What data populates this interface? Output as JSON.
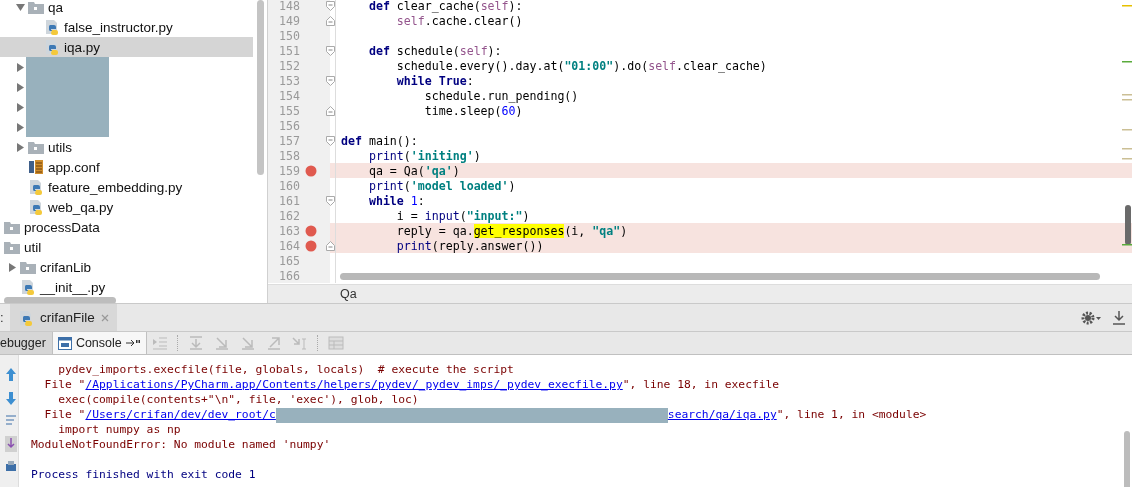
{
  "project_tree": {
    "continued_items": [
      {
        "label": "qa",
        "kind": "folder",
        "expanded": true,
        "selected": false,
        "children": [
          {
            "label": "false_instructor.py",
            "kind": "python",
            "selected": false
          },
          {
            "label": "iqa.py",
            "kind": "python",
            "selected": true
          }
        ]
      },
      {
        "kind": "redacted",
        "expanded": false
      },
      {
        "kind": "redacted",
        "expanded": false
      },
      {
        "kind": "redacted",
        "expanded": false
      },
      {
        "kind": "redacted",
        "expanded": false
      },
      {
        "label": "utils",
        "kind": "folder",
        "expanded": false,
        "selected": false
      },
      {
        "label": "app.conf",
        "kind": "config",
        "selected": false
      },
      {
        "label": "feature_embedding.py",
        "kind": "python",
        "selected": false
      },
      {
        "label": "web_qa.py",
        "kind": "python",
        "selected": false
      }
    ],
    "items": [
      {
        "label": "processData",
        "kind": "folder",
        "selected": false
      },
      {
        "label": "util",
        "kind": "folder",
        "selected": false,
        "children": [
          {
            "label": "crifanLib",
            "kind": "folder",
            "expanded": false,
            "selected": false
          },
          {
            "label": "__init__.py",
            "kind": "python",
            "selected": false
          }
        ]
      }
    ]
  },
  "editor": {
    "lines": [
      {
        "number": "148",
        "fold_start": true,
        "fold_end": false,
        "breakpoint": false,
        "tokens": [
          {
            "kind": "kw",
            "text": "    def"
          },
          {
            "kind": "plain",
            "text": " clear_cache("
          },
          {
            "kind": "self",
            "text": "self"
          },
          {
            "kind": "plain",
            "text": "):"
          }
        ]
      },
      {
        "number": "149",
        "fold_start": false,
        "fold_end": true,
        "breakpoint": false,
        "tokens": [
          {
            "kind": "self",
            "text": "        self"
          },
          {
            "kind": "plain",
            "text": ".cache.clear()"
          }
        ]
      },
      {
        "number": "150",
        "fold_start": false,
        "fold_end": false,
        "breakpoint": false
      },
      {
        "number": "151",
        "fold_start": true,
        "fold_end": false,
        "breakpoint": false,
        "tokens": [
          {
            "kind": "kw",
            "text": "    def"
          },
          {
            "kind": "plain",
            "text": " schedule("
          },
          {
            "kind": "self",
            "text": "self"
          },
          {
            "kind": "plain",
            "text": "):"
          }
        ]
      },
      {
        "number": "152",
        "fold_start": false,
        "fold_end": false,
        "breakpoint": false,
        "tokens": [
          {
            "kind": "plain",
            "text": "        schedule.every().day.at("
          },
          {
            "kind": "str",
            "text": "\"01:00\""
          },
          {
            "kind": "plain",
            "text": ").do("
          },
          {
            "kind": "self",
            "text": "self"
          },
          {
            "kind": "plain",
            "text": ".clear_cache)"
          }
        ]
      },
      {
        "number": "153",
        "fold_start": true,
        "fold_end": false,
        "breakpoint": false,
        "tokens": [
          {
            "kind": "kw",
            "text": "        while True"
          },
          {
            "kind": "plain",
            "text": ":"
          }
        ]
      },
      {
        "number": "154",
        "fold_start": false,
        "fold_end": false,
        "breakpoint": false,
        "tokens": [
          {
            "kind": "plain",
            "text": "            schedule.run_pending()"
          }
        ]
      },
      {
        "number": "155",
        "fold_start": false,
        "fold_end": true,
        "breakpoint": false,
        "tokens": [
          {
            "kind": "plain",
            "text": "            time.sleep("
          },
          {
            "kind": "num",
            "text": "60"
          },
          {
            "kind": "plain",
            "text": ")"
          }
        ]
      },
      {
        "number": "156",
        "fold_start": false,
        "fold_end": false,
        "breakpoint": false
      },
      {
        "number": "157",
        "fold_start": true,
        "fold_end": false,
        "breakpoint": false,
        "tokens": [
          {
            "kind": "kw",
            "text": "def"
          },
          {
            "kind": "plain",
            "text": " main():"
          }
        ]
      },
      {
        "number": "158",
        "fold_start": false,
        "fold_end": false,
        "breakpoint": false,
        "tokens": [
          {
            "kind": "builtin",
            "text": "    print"
          },
          {
            "kind": "plain",
            "text": "("
          },
          {
            "kind": "str",
            "text": "'initing'"
          },
          {
            "kind": "plain",
            "text": ")"
          }
        ]
      },
      {
        "number": "159",
        "fold_start": false,
        "fold_end": false,
        "breakpoint": true,
        "tokens": [
          {
            "kind": "plain",
            "text": "    qa = Qa("
          },
          {
            "kind": "str",
            "text": "'qa'"
          },
          {
            "kind": "plain",
            "text": ")"
          }
        ]
      },
      {
        "number": "160",
        "fold_start": false,
        "fold_end": false,
        "breakpoint": false,
        "tokens": [
          {
            "kind": "builtin",
            "text": "    print"
          },
          {
            "kind": "plain",
            "text": "("
          },
          {
            "kind": "str",
            "text": "'model loaded'"
          },
          {
            "kind": "plain",
            "text": ")"
          }
        ]
      },
      {
        "number": "161",
        "fold_start": true,
        "fold_end": false,
        "breakpoint": false,
        "tokens": [
          {
            "kind": "kw",
            "text": "    while"
          },
          {
            "kind": "num",
            "text": " 1"
          },
          {
            "kind": "plain",
            "text": ":"
          }
        ]
      },
      {
        "number": "162",
        "fold_start": false,
        "fold_end": false,
        "breakpoint": false,
        "tokens": [
          {
            "kind": "plain",
            "text": "        i = "
          },
          {
            "kind": "builtin",
            "text": "input"
          },
          {
            "kind": "plain",
            "text": "("
          },
          {
            "kind": "str",
            "text": "\"input:\""
          },
          {
            "kind": "plain",
            "text": ")"
          }
        ]
      },
      {
        "number": "163",
        "fold_start": false,
        "fold_end": false,
        "breakpoint": true,
        "tokens": [
          {
            "kind": "plain",
            "text": "        reply = qa."
          },
          {
            "kind": "highlight",
            "text": "get_responses"
          },
          {
            "kind": "plain",
            "text": "(i, "
          },
          {
            "kind": "str",
            "text": "\"qa\""
          },
          {
            "kind": "plain",
            "text": ")"
          }
        ]
      },
      {
        "number": "164",
        "fold_start": false,
        "fold_end": true,
        "breakpoint": true,
        "tokens": [
          {
            "kind": "builtin",
            "text": "        print"
          },
          {
            "kind": "plain",
            "text": "(reply.answer())"
          }
        ]
      },
      {
        "number": "165",
        "fold_start": false,
        "fold_end": false,
        "breakpoint": false
      },
      {
        "number": "166",
        "fold_start": false,
        "fold_end": false,
        "breakpoint": false
      }
    ],
    "breadcrumb": "Qa"
  },
  "tool_window": {
    "title_fragment": ":",
    "run_tabs": [
      {
        "label": "crifanFile",
        "selected": true
      }
    ],
    "subtabs": [
      {
        "label": "ebugger",
        "selected": false
      },
      {
        "label": "Console",
        "selected": true
      }
    ],
    "console": {
      "lines": [
        {
          "kind": "error",
          "segments": [
            {
              "kind": "text",
              "text": "    pydev_imports.execfile(file, globals, locals)  # execute the script"
            }
          ]
        },
        {
          "kind": "error",
          "segments": [
            {
              "kind": "text",
              "text": "  File \""
            },
            {
              "kind": "link",
              "text": "/Applications/PyCharm.app/Contents/helpers/pydev/_pydev_imps/_pydev_execfile.py"
            },
            {
              "kind": "text",
              "text": "\", line 18, in execfile"
            }
          ]
        },
        {
          "kind": "error",
          "segments": [
            {
              "kind": "text",
              "text": "    exec(compile(contents+\"\\n\", file, 'exec'), glob, loc)"
            }
          ]
        },
        {
          "kind": "error",
          "segments": [
            {
              "kind": "text",
              "text": "  File \""
            },
            {
              "kind": "link",
              "text": "/Users/crifan/dev/dev_root/c"
            },
            {
              "kind": "redacted"
            },
            {
              "kind": "link",
              "text": "search/qa/iqa.py"
            },
            {
              "kind": "text",
              "text": "\", line 1, in <module>"
            }
          ]
        },
        {
          "kind": "error",
          "segments": [
            {
              "kind": "text",
              "text": "    import numpy as np"
            }
          ]
        },
        {
          "kind": "error",
          "segments": [
            {
              "kind": "text",
              "text": "ModuleNotFoundError: No module named 'numpy'"
            }
          ]
        },
        {
          "kind": "blank"
        },
        {
          "kind": "info",
          "segments": [
            {
              "kind": "text",
              "text": "Process finished with exit code 1"
            }
          ]
        }
      ]
    }
  }
}
